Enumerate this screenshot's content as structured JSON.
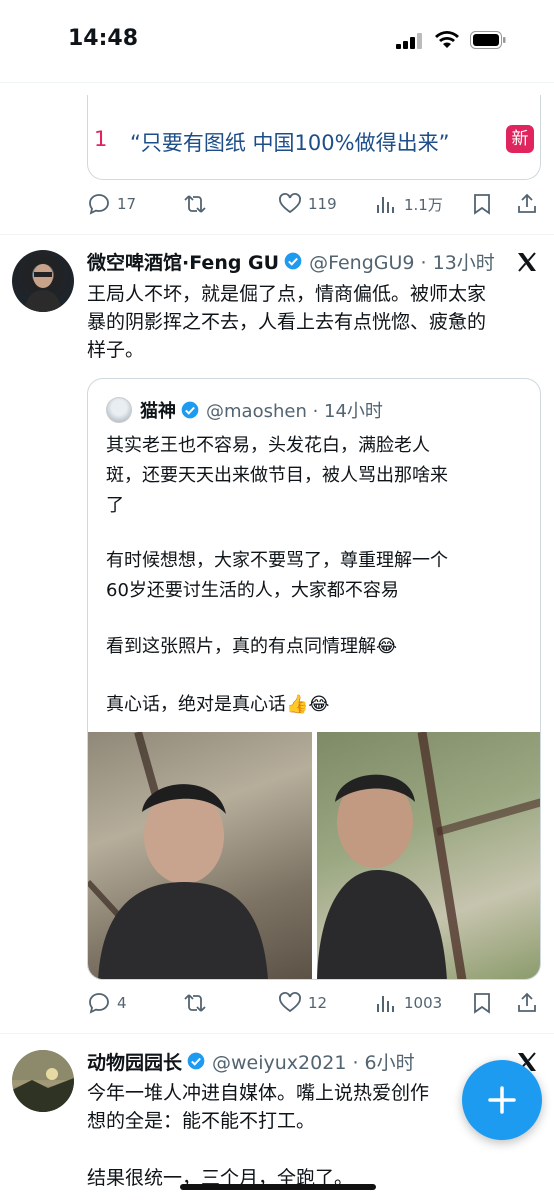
{
  "status": {
    "time": "14:48"
  },
  "trend": {
    "rank": "1",
    "text": "“只要有图纸 中国100%做得出来”",
    "badge": "新"
  },
  "actions1": {
    "replies": "17",
    "reposts": "",
    "likes": "119",
    "views": "1.1万"
  },
  "tweet1": {
    "name": "微空啤酒馆·Feng GU",
    "handle": "@FengGU9 · 13小时",
    "lines": [
      "王局人不坏，就是倔了点，情商偏低。被师太家",
      "暴的阴影挥之不去，人看上去有点恍惚、疲惫的",
      "样子。"
    ],
    "quote": {
      "name": "猫神",
      "handle": "@maoshen · 14小时",
      "lines": [
        "其实老王也不容易，头发花白，满脸老人",
        "斑，还要天天出来做节目，被人骂出那啥来",
        "了"
      ],
      "lines2": [
        "有时候想想，大家不要骂了，尊重理解一个",
        "60岁还要讨生活的人，大家都不容易"
      ],
      "line3": "看到这张照片，真的有点同情理解😂",
      "line4": "真心话，绝对是真心话👍😂"
    },
    "actions": {
      "replies": "4",
      "reposts": "",
      "likes": "12",
      "views": "1003"
    }
  },
  "tweet2": {
    "name": "动物园园长",
    "handle": "@weiyux2021 · 6小时",
    "lines": [
      "今年一堆人冲进自媒体。嘴上说热爱创作",
      "想的全是：能不能不打工。"
    ],
    "line3": "结果很统一，三个月，全跑了。"
  },
  "colors": {
    "accent": "#1d9bf0",
    "trend": "#e0245e",
    "muted": "#536471"
  },
  "icons": [
    "reply-icon",
    "repost-icon",
    "like-icon",
    "views-icon",
    "bookmark-icon",
    "share-icon",
    "verified-icon",
    "x-logo-icon",
    "compose-plus-icon"
  ]
}
